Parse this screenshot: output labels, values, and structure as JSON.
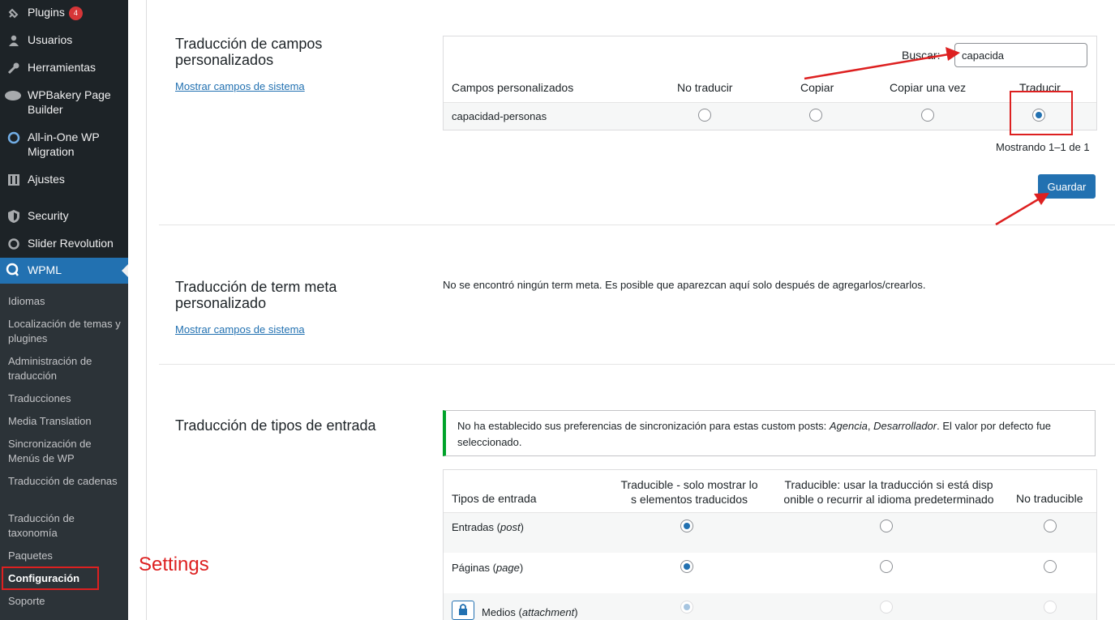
{
  "sidebar": {
    "items": [
      {
        "label": "Plugins",
        "icon": "plugin-icon",
        "badge": "4"
      },
      {
        "label": "Usuarios",
        "icon": "users-icon"
      },
      {
        "label": "Herramientas",
        "icon": "tools-icon"
      },
      {
        "label": "WPBakery Page Builder",
        "icon": "wpbakery-icon"
      },
      {
        "label": "All-in-One WP Migration",
        "icon": "migration-icon"
      },
      {
        "label": "Ajustes",
        "icon": "settings-icon"
      },
      {
        "label": "Security",
        "icon": "shield-icon"
      },
      {
        "label": "Slider Revolution",
        "icon": "refresh-icon"
      },
      {
        "label": "WPML",
        "icon": "wpml-icon"
      }
    ],
    "submenu": [
      "Idiomas",
      "Localización de temas y plugines",
      "Administración de traducción",
      "Traducciones",
      "Media Translation",
      "Sincronización de Menús de WP",
      "Traducción de cadenas",
      "Traducción de taxonomía",
      "Paquetes",
      "Configuración",
      "Soporte"
    ]
  },
  "custom_fields": {
    "title": "Traducción de campos personalizados",
    "link": "Mostrar campos de sistema",
    "search_label": "Buscar:",
    "search_value": "capacida",
    "columns": [
      "Campos personalizados",
      "No traducir",
      "Copiar",
      "Copiar una vez",
      "Traducir"
    ],
    "rows": [
      {
        "name": "capacidad-personas",
        "selected": "Traducir"
      }
    ],
    "showing": "Mostrando 1–1 de 1",
    "save": "Guardar"
  },
  "term_meta": {
    "title": "Traducción de term meta personalizado",
    "link": "Mostrar campos de sistema",
    "message": "No se encontró ningún term meta. Es posible que aparezcan aquí solo después de agregarlos/crearlos."
  },
  "post_types": {
    "title": "Traducción de tipos de entrada",
    "notice_pre": "No ha establecido sus preferencias de sincronización para estas custom posts: ",
    "notice_em1": "Agencia",
    "notice_sep": ", ",
    "notice_em2": "Desarrollador",
    "notice_post": ". El valor por defecto fue seleccionado.",
    "columns": [
      "Tipos de entrada",
      "Traducible - solo mostrar los elementos traducidos",
      "Traducible: usar la traducción si está disponible o recurrir al idioma predeterminado",
      "No traducible"
    ],
    "col1_line1": "Traducible - solo mostrar lo",
    "col1_line2": "s elementos traducidos",
    "col2_line1": "Traducible: usar la traducción si está disp",
    "col2_line2": "onible o recurrir al idioma predeterminado",
    "rows": [
      {
        "name": "Entradas",
        "slug": "post"
      },
      {
        "name": "Páginas",
        "slug": "page"
      },
      {
        "name": "Medios",
        "slug": "attachment"
      }
    ]
  },
  "annotation": "Settings",
  "colors": {
    "accent": "#2271b1",
    "sidebar": "#1d2327",
    "annotation": "#dd2020",
    "success": "#00a32a"
  }
}
